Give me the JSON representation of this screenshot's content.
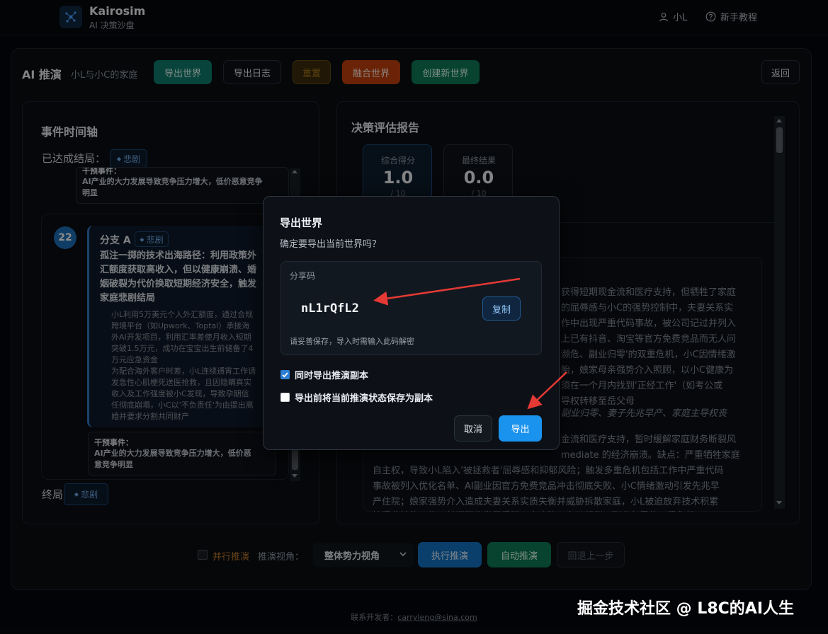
{
  "header": {
    "app_name": "Kairosim",
    "app_subtitle": "AI 决策沙盘",
    "user_name": "小L",
    "tutorial": "新手教程"
  },
  "toolbar": {
    "title": "AI 推演",
    "world_name": "小L与小C的家庭",
    "export_world": "导出世界",
    "export_log": "导出日志",
    "reset": "重置",
    "merge_world": "融合世界",
    "create_world": "创建新世界",
    "back": "返回"
  },
  "timeline": {
    "title": "事件时间轴",
    "reached_label": "已达成结局：",
    "reached_tag": "悲剧",
    "top_card": {
      "label": "干预事件：",
      "text_lines": [
        "AI产业的大力发展导致竞争压力增大，低价恶意竞争",
        "明显"
      ]
    },
    "node_number": "22",
    "branch": {
      "name": "分支 A",
      "tag": "悲剧",
      "desc_lines": [
        "孤注一掷的技术出海路径：利用政策外",
        "汇额度获取高收入，但以健康崩溃、婚",
        "姻破裂为代价换取短期经济安全，触发",
        "家庭悲剧结局"
      ],
      "detail_lines": [
        "小L利用5万美元个人外汇额度，通过合规",
        "跨境平台（如Upwork、Toptal）承接海",
        "外AI开发项目，利用汇率差使月收入短期",
        "突破1.5万元，成功在宝宝出生前储备了4",
        "万元应急资金",
        "为配合海外客户时差，小L连续通宵工作诱",
        "发急性心肌梗死送医抢救，且因隐瞒真实",
        "收入及工作强度被小C发现，导致孕期信",
        "任彻底崩塌，小C以'不负责任'为由提出离",
        "婚并要求分割共同财产"
      ]
    },
    "bottom_card": {
      "label": "干预事件：",
      "text_lines": [
        "AI产业的大力发展导致竞争压力增大，低价恶",
        "意竞争明显"
      ]
    },
    "end_label": "终局",
    "end_tag": "悲剧"
  },
  "report": {
    "title": "决策评估报告",
    "score_label": "综合得分",
    "score_value": "1.0",
    "score_max": "/ 10",
    "result_label": "最终结果",
    "result_value": "0.0",
    "result_max": "/ 10",
    "lines": [
      "获得短期现金流和医疗支持，但牺牲了家庭",
      "的屈辱感与小C的强势控制中，夫妻关系实",
      "作中出现严重代码事故，被公司记过并列入",
      "上已有抖音、淘宝等官方免费竞品而无人问",
      "濒危、副业归零'的双重危机，小C因情绪激",
      "胎，娘家母亲强势介入照顾，以小C健康为",
      "须在一个月内找到'正经工作'（如考公或",
      "导权转移至岳父母",
      "副业归零、妻子先兆早产、家庭主导权丧",
      "",
      "金流和医疗支持，暂时缓解家庭财务断裂风",
      "mediate 的经济崩溃。缺点：严重牺牲家庭",
      "自主权，导致小L陷入'被拯救者'屈辱感和抑郁风险；触发多重危机包括工作中严重代码",
      "事故被列入优化名单、AI副业因官方免费竞品冲击彻底失败、小C情绪激动引发先兆早",
      "产住院；娘家强势介入造成夫妻关系实质失衡并威胁拆散家庭，小L被迫放弃技术积累",
      "接受非技能工作，长期职业发展受阻，家庭陷入主从颠倒，副业归零的双重危机"
    ]
  },
  "controls": {
    "parallel": "并行推演",
    "view_label": "推演视角：",
    "view_selected": "整体势力视角",
    "run": "执行推演",
    "auto": "自动推演",
    "undo": "回退上一步"
  },
  "footer": {
    "label": "联系开发者：",
    "email": "carryleng@sina.com"
  },
  "watermark": "掘金技术社区 @ L8C的AI人生",
  "modal": {
    "title": "导出世界",
    "desc": "确定要导出当前世界吗？",
    "share_label": "分享码",
    "share_code": "nL1rQfL2",
    "copy": "复制",
    "hint": "请妥善保存，导入时需输入此码解密",
    "opt_include_copy": "同时导出推演副本",
    "opt_include_copy_checked": true,
    "opt_save_state": "导出前将当前推演状态保存为副本",
    "opt_save_state_checked": false,
    "cancel": "取消",
    "confirm": "导出"
  },
  "colors": {
    "accent": "#1a93ef",
    "teal": "#127c6d",
    "orange": "#c2410c",
    "green": "#0d7a55",
    "tragedy_tag": "#6fa8e6",
    "arrow": "#e53935"
  }
}
